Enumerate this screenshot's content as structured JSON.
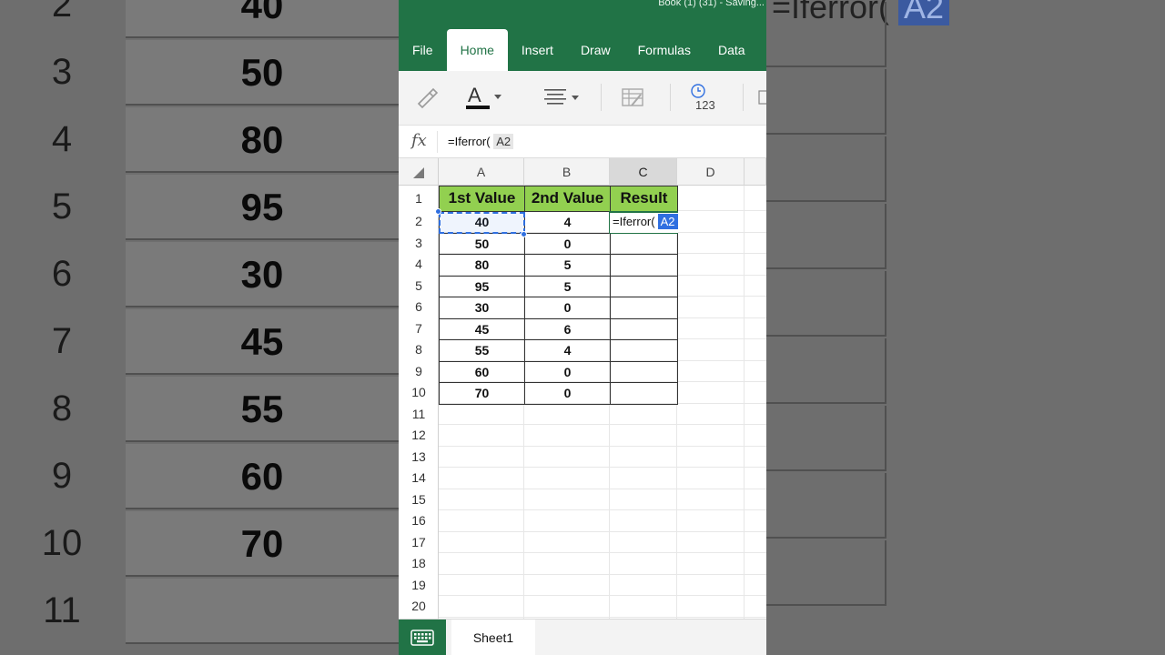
{
  "app": {
    "title": "Book (1) (31) - Saving...",
    "tabs": [
      "File",
      "Home",
      "Insert",
      "Draw",
      "Formulas",
      "Data"
    ],
    "active_tab": "Home",
    "accent": "#217346"
  },
  "formula_bar": {
    "fx_label": "fx",
    "text": "=Iferror(",
    "ref": "A2"
  },
  "columns": [
    "A",
    "B",
    "C",
    "D"
  ],
  "selected_column": "C",
  "rows": [
    "1",
    "2",
    "3",
    "4",
    "5",
    "6",
    "7",
    "8",
    "9",
    "10",
    "11",
    "12",
    "13",
    "14",
    "15",
    "16",
    "17",
    "18",
    "19",
    "20"
  ],
  "headers": {
    "a": "1st Value",
    "b": "2nd Value",
    "c": "Result"
  },
  "table": [
    {
      "a": "40",
      "b": "4"
    },
    {
      "a": "50",
      "b": "0"
    },
    {
      "a": "80",
      "b": "5"
    },
    {
      "a": "95",
      "b": "5"
    },
    {
      "a": "30",
      "b": "0"
    },
    {
      "a": "45",
      "b": "6"
    },
    {
      "a": "55",
      "b": "4"
    },
    {
      "a": "60",
      "b": "0"
    },
    {
      "a": "70",
      "b": "0"
    }
  ],
  "editing_cell": {
    "address": "C2",
    "text": "=Iferror(",
    "ref": "A2"
  },
  "sheet_tab": "Sheet1",
  "header_fill": "#92d050",
  "background_zoom": {
    "rows": [
      "2",
      "3",
      "4",
      "5",
      "6",
      "7",
      "8",
      "9",
      "10",
      "11"
    ],
    "values": [
      "40",
      "50",
      "80",
      "95",
      "30",
      "45",
      "55",
      "60",
      "70",
      ""
    ],
    "formula_text": "=Iferror(",
    "formula_ref": "A2"
  }
}
